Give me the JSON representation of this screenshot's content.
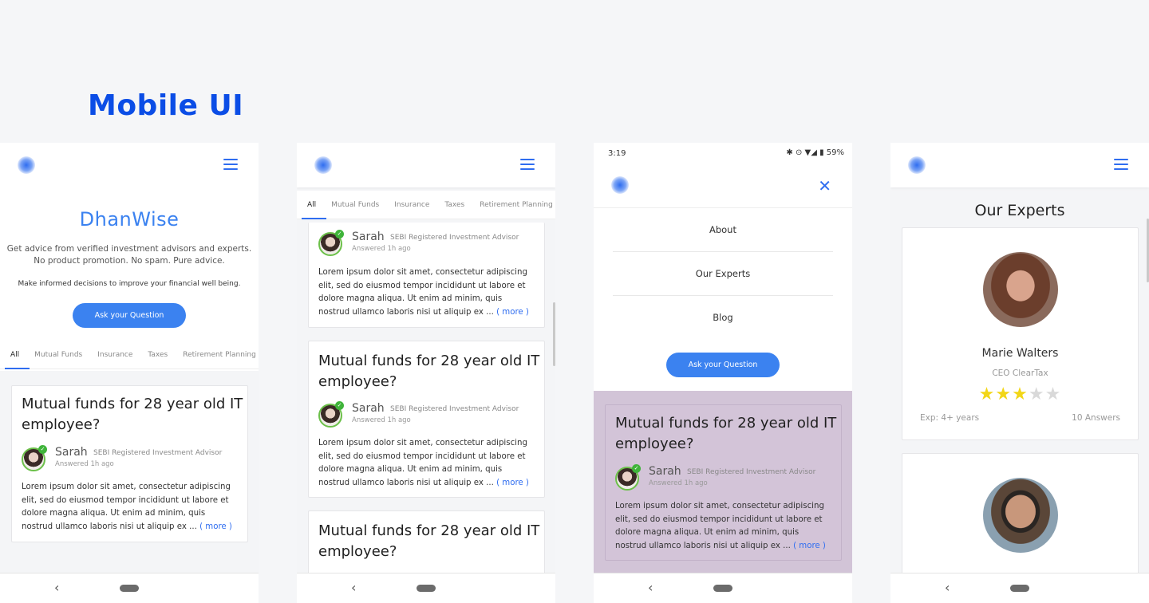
{
  "page": {
    "title": "Mobile UI"
  },
  "common": {
    "question_title": "Mutual funds for 28 year old IT employee?",
    "author_name": "Sarah",
    "author_role": "SEBI Registered Investment Advisor",
    "answered": "Answered 1h ago",
    "answer_text": "Lorem ipsum dolor sit amet, consectetur adipiscing elit, sed do eiusmod tempor incididunt ut labore et dolore magna aliqua. Ut enim ad minim, quis nostrud ullamco laboris nisi ut aliquip ex ...",
    "more_label": "( more )",
    "ask_button": "Ask your Question",
    "nav_back": "‹",
    "tabs": [
      "All",
      "Mutual Funds",
      "Insurance",
      "Taxes",
      "Retirement Planning"
    ]
  },
  "screen1": {
    "brand": "DhanWise",
    "subtitle_line1": "Get advice from verified investment advisors and experts.",
    "subtitle_line2": "No product promotion. No spam. Pure advice.",
    "note": "Make informed decisions to improve your financial well being."
  },
  "screen3": {
    "status_time": "3:19",
    "status_icons": "✱ ⊙ ▼◢ ▮ 59%",
    "close": "✕",
    "menu_items": [
      "About",
      "Our Experts",
      "Blog"
    ]
  },
  "screen4": {
    "title": "Our Experts",
    "experts": [
      {
        "name": "Marie Walters",
        "role": "CEO ClearTax",
        "rating": 3,
        "exp": "Exp: 4+ years",
        "answers": "10 Answers"
      }
    ]
  },
  "icons": [
    "logo-icon",
    "hamburger-icon",
    "close-icon",
    "verified-check-icon",
    "star-icon",
    "back-icon",
    "home-icon"
  ],
  "colors": {
    "accent": "#3b82f0",
    "title": "#0b4de6",
    "verified": "#3fb43a",
    "star": "#f2d617",
    "overlay": "#d2c4d7"
  }
}
